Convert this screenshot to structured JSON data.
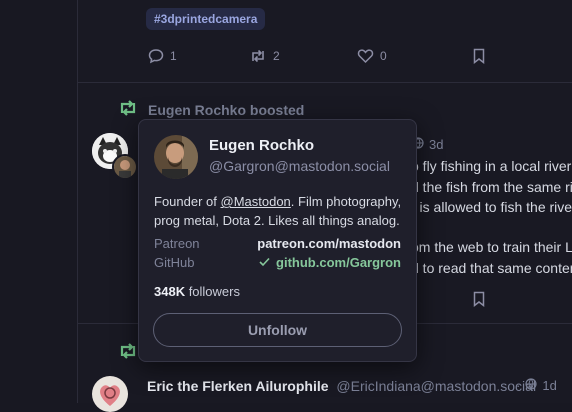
{
  "top_post": {
    "hashtag": "#3dprintedcamera",
    "replies": "1",
    "boosts": "2",
    "favourites": "0"
  },
  "boosted_post": {
    "boost_label": "Eugen Rochko boosted",
    "time": "3d",
    "lines": [
      "o fly fishing in a local river",
      "d the fish from the same riv",
      "r is allowed to fish the rive",
      "om the web to train their LL",
      "d to read that same conten"
    ]
  },
  "next_post": {
    "display_name": "Eric the Flerken Ailurophile",
    "acct": "@EricIndiana@mastodon.social",
    "separator": "·",
    "time": "1d"
  },
  "hover_card": {
    "display_name": "Eugen Rochko",
    "handle": "@Gargron@mastodon.social",
    "bio_prefix": "Founder of ",
    "bio_link": "@Mastodon",
    "bio_suffix": ". Film photography, prog metal, Dota 2. Likes all things analog.",
    "fields": [
      {
        "label": "Patreon",
        "value": "patreon.com/mastodon",
        "verified": false
      },
      {
        "label": "GitHub",
        "value": "github.com/Gargron",
        "verified": true
      }
    ],
    "followers_count": "348K",
    "followers_label": " followers",
    "unfollow_label": "Unfollow"
  },
  "colors": {
    "background": "#181822",
    "card": "#1f1f2b",
    "boost_green": "#6fbf86",
    "verified_green": "#86c79b",
    "hashtag_bg": "#262a45"
  }
}
